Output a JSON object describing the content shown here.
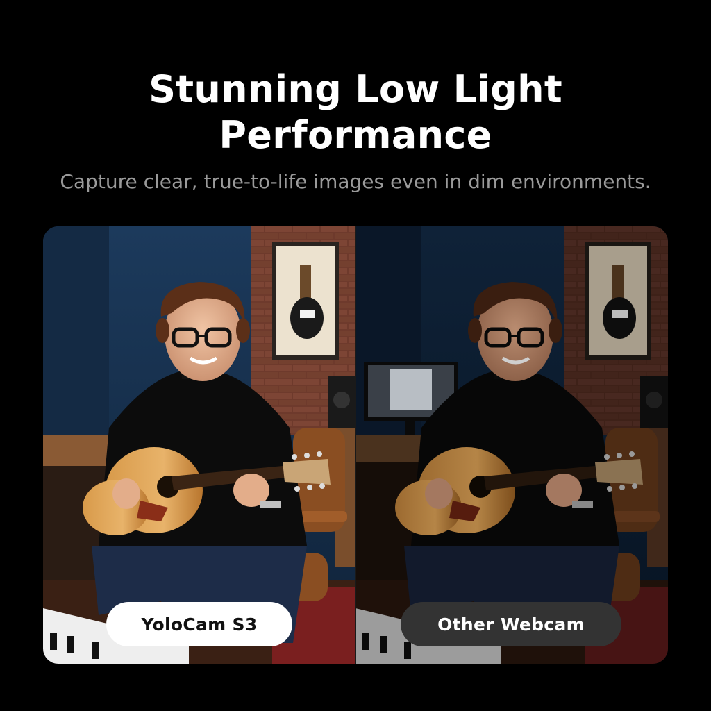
{
  "header": {
    "title_line1": "Stunning Low Light",
    "title_line2": "Performance",
    "subtitle": "Capture clear, true-to-life images even in dim environments."
  },
  "comparison": {
    "left_label": "YoloCam S3",
    "right_label": "Other Webcam"
  },
  "colors": {
    "background": "#000000",
    "left_pill_bg": "#ffffff",
    "right_pill_bg": "#333333",
    "subtitle_text": "#9a9a9a"
  }
}
